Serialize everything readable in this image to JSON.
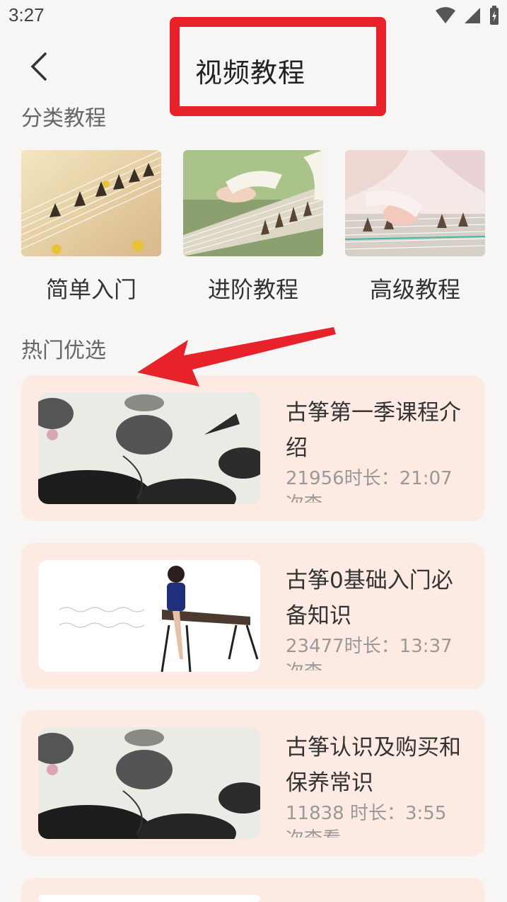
{
  "status_bar": {
    "time": "3:27"
  },
  "header": {
    "title": "视频教程"
  },
  "categories_section": {
    "title": "分类教程",
    "items": [
      {
        "label": "简单入门",
        "thumb_icon": "guzheng-strings-image"
      },
      {
        "label": "进阶教程",
        "thumb_icon": "guzheng-hands-image"
      },
      {
        "label": "高级教程",
        "thumb_icon": "guzheng-player-image"
      }
    ]
  },
  "hot_section": {
    "title": "热门优选",
    "videos": [
      {
        "title": "古筝第一季课程介绍",
        "views": "21956",
        "duration_label": "时长：21:07",
        "cut_text": "次查"
      },
      {
        "title": "古筝0基础入门必备知识",
        "views": "23477",
        "duration_label": "时长：13:37",
        "cut_text": "次查"
      },
      {
        "title": "古筝认识及购买和保养常识",
        "views": "11838",
        "duration_label": " 时长：3:55",
        "cut_text": "次查看"
      }
    ]
  },
  "colors": {
    "card_bg": "#fdeae3",
    "annotation_red": "#e8222b",
    "page_bg": "#f7f6f4"
  }
}
